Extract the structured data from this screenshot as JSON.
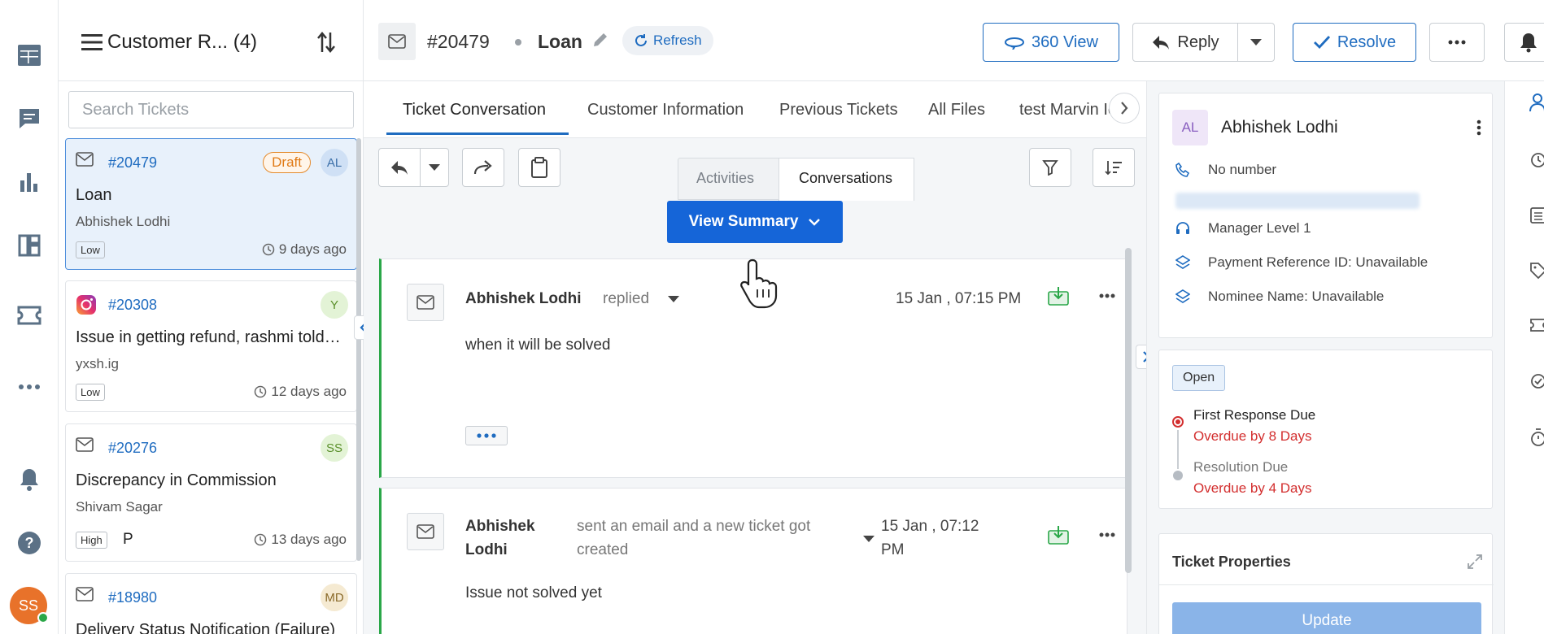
{
  "app": {
    "user_initials": "SS",
    "colors": {
      "accent": "#1f6cc0",
      "primary_button": "#1565d8",
      "success": "#2aa748",
      "danger": "#d32f2f",
      "avatar_orange": "#e8722a"
    }
  },
  "leftnav": {
    "icons": [
      "table-icon",
      "chat-icon",
      "bar-chart-icon",
      "dashboard-icon",
      "ticket-icon",
      "more-icon",
      "bell-icon",
      "help-icon"
    ]
  },
  "ticket_list": {
    "title": "Customer R... (4)",
    "search_placeholder": "Search Tickets",
    "tickets": [
      {
        "id": "#20479",
        "subject": "Loan",
        "customer": "Abhishek Lodhi",
        "priority": "Low",
        "age": "9 days ago",
        "badge": "Draft",
        "avatar": "AL",
        "channel": "email-icon"
      },
      {
        "id": "#20308",
        "subject": "Issue in getting refund, rashmi told me t",
        "customer": "yxsh.ig",
        "priority": "Low",
        "age": "12 days ago",
        "avatar": "Y",
        "channel": "instagram-icon"
      },
      {
        "id": "#20276",
        "subject": "Discrepancy in Commission",
        "customer": "Shivam Sagar",
        "priority": "High",
        "extra": "P",
        "age": "13 days ago",
        "avatar": "SS",
        "channel": "email-icon"
      },
      {
        "id": "#18980",
        "subject": "Delivery Status Notification (Failure)",
        "avatar": "MD",
        "channel": "email-icon"
      }
    ]
  },
  "header": {
    "ticket_id": "#20479",
    "subject": "Loan",
    "refresh_label": "Refresh",
    "view360_label": "360 View",
    "reply_label": "Reply",
    "resolve_label": "Resolve"
  },
  "tabs": [
    "Ticket Conversation",
    "Customer Information",
    "Previous Tickets",
    "All Files",
    "test Marvin Ic"
  ],
  "conversation": {
    "subtabs": [
      "Activities",
      "Conversations"
    ],
    "view_summary_label": "View Summary",
    "messages": [
      {
        "author": "Abhishek Lodhi",
        "action": "replied",
        "time": "15 Jan , 07:15 PM",
        "body": "when it will be solved"
      },
      {
        "author": "Abhishek Lodhi",
        "action": "sent an email and a new ticket got created",
        "time": "15 Jan , 07:12 PM",
        "body": "Issue not solved yet"
      }
    ]
  },
  "customer": {
    "initials": "AL",
    "name": "Abhishek Lodhi",
    "phone": "No number",
    "role": "Manager Level 1",
    "payment_ref": "Payment Reference ID: Unavailable",
    "nominee": "Nominee Name: Unavailable"
  },
  "sla": {
    "status": "Open",
    "first_response_label": "First Response Due",
    "first_response_value": "Overdue by 8 Days",
    "resolution_label": "Resolution Due",
    "resolution_value": "Overdue by 4 Days"
  },
  "properties": {
    "title": "Ticket Properties",
    "update_label": "Update"
  },
  "right_strip_icons": [
    "person-icon",
    "history-icon",
    "list-icon",
    "tag-icon",
    "ticket-icon",
    "check-circle-icon",
    "timer-icon"
  ]
}
